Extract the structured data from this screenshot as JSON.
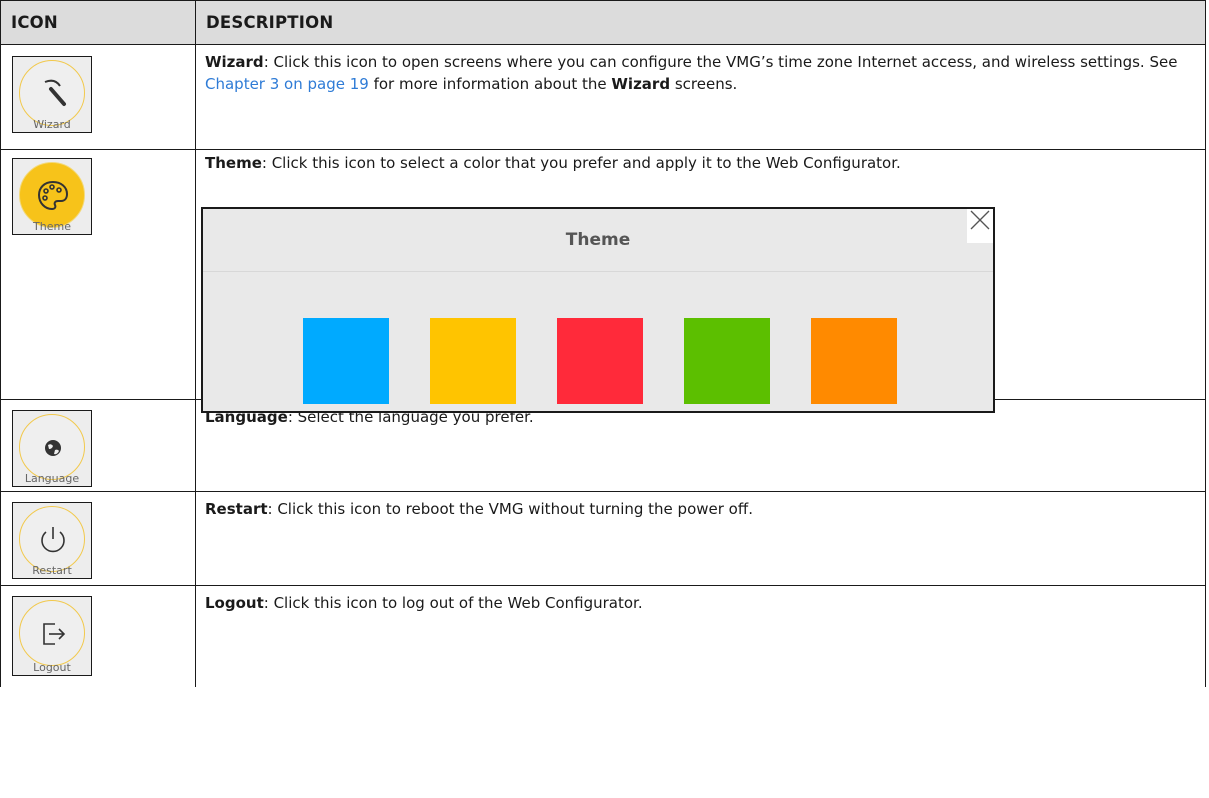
{
  "table": {
    "header_icon": "ICON",
    "header_description": "DESCRIPTION"
  },
  "rows": {
    "wizard": {
      "icon": "wand-icon",
      "caption": "Wizard",
      "term": "Wizard",
      "text_1": ": Click this icon to open screens where you can configure the VMG’s time zone Internet access, and wireless settings. See ",
      "link": "Chapter 3 on page 19",
      "text_2": " for more information about the ",
      "term_2": "Wizard",
      "text_3": " screens."
    },
    "theme": {
      "icon": "palette-icon",
      "caption": "Theme",
      "term": "Theme",
      "text": ": Click this icon to select a color that you prefer and apply it to the Web Configurator."
    },
    "language": {
      "icon": "globe-icon",
      "caption": "Language",
      "term": "Language",
      "text": ": Select the language you prefer."
    },
    "restart": {
      "icon": "power-icon",
      "caption": "Restart",
      "term": "Restart",
      "text": ": Click this icon to reboot the VMG without turning the power off."
    },
    "logout": {
      "icon": "logout-icon",
      "caption": "Logout",
      "term": "Logout",
      "text": ": Click this icon to log out of the Web Configurator."
    }
  },
  "theme_dialog": {
    "title": "Theme",
    "close_icon": "close-icon",
    "swatches": [
      {
        "name": "blue",
        "color": "#00aaff"
      },
      {
        "name": "yellow",
        "color": "#ffc400"
      },
      {
        "name": "red",
        "color": "#ff2a3a"
      },
      {
        "name": "green",
        "color": "#5cbf00"
      },
      {
        "name": "orange",
        "color": "#ff8a00"
      }
    ]
  },
  "colors": {
    "header_bg": "#dcdcdc",
    "link": "#2e7bd6",
    "icon_ring": "#f2c94c",
    "theme_icon_fill": "#f7c31a"
  }
}
